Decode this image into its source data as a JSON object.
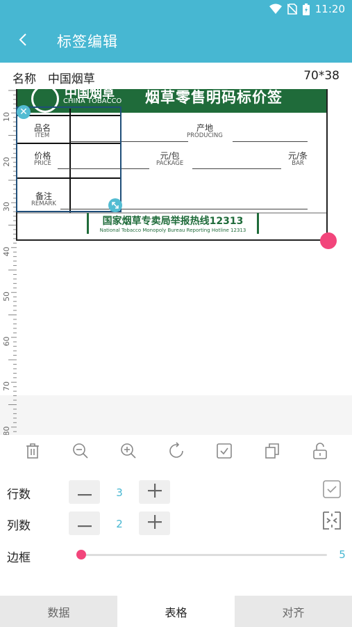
{
  "status_bar": {
    "time": "11:20"
  },
  "app_bar": {
    "title": "标签编辑"
  },
  "label_info": {
    "name_label": "名称",
    "name_value": "中国烟草",
    "size": "70*38"
  },
  "ruler": {
    "marks": [
      "10",
      "20",
      "30",
      "40",
      "50",
      "60",
      "70",
      "80"
    ]
  },
  "label": {
    "brand_cn": "中国烟草",
    "brand_en": "CHINA TOBACCO",
    "slogan": "烟草零售明码标价签",
    "fields": {
      "item_cn": "品名",
      "item_en": "ITEM",
      "origin_cn": "产地",
      "origin_en": "PRODUCING",
      "price_cn": "价格",
      "price_en": "PRICE",
      "package_cn": "元/包",
      "package_en": "PACKAGE",
      "bar_cn": "元/条",
      "bar_en": "BAR",
      "remark_cn": "备注",
      "remark_en": "REMARK"
    },
    "hotline_cn": "国家烟草专卖局举报热线12313",
    "hotline_en": "National Tobacco Monopoly Bureau Reporting Hotline 12313"
  },
  "toolbar": {
    "icons": [
      "trash-icon",
      "zoom-out-icon",
      "zoom-in-icon",
      "rotate-icon",
      "checkbox-icon",
      "copy-icon",
      "unlock-icon"
    ]
  },
  "properties": {
    "rows_label": "行数",
    "rows_value": "3",
    "cols_label": "列数",
    "cols_value": "2",
    "border_label": "边框",
    "border_value": "5"
  },
  "tabs": [
    {
      "label": "数据"
    },
    {
      "label": "表格"
    },
    {
      "label": "对齐"
    }
  ],
  "colors": {
    "primary": "#47b7d2",
    "accent": "#f2457b",
    "label_green": "#1f6b3a"
  }
}
